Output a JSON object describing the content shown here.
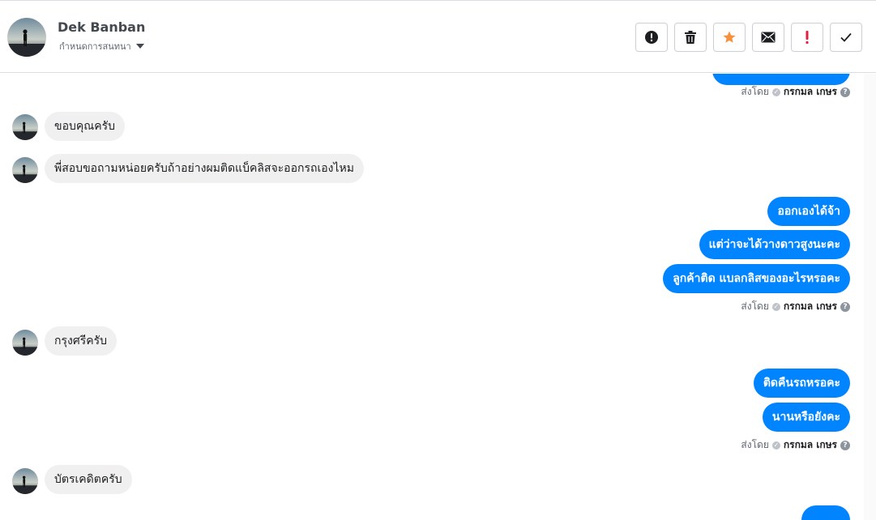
{
  "header": {
    "contact_name": "Dek Banban",
    "conversation_menu": "กำหนดการสนทนา",
    "actions": [
      {
        "name": "alert-button",
        "icon": "exclamation-circle-icon"
      },
      {
        "name": "delete-button",
        "icon": "trash-icon"
      },
      {
        "name": "star-button",
        "icon": "star-icon",
        "color": "#f5923e"
      },
      {
        "name": "mail-button",
        "icon": "envelope-icon"
      },
      {
        "name": "important-button",
        "icon": "exclamation-icon",
        "color": "#e41e3f"
      },
      {
        "name": "done-button",
        "icon": "checkmark-icon"
      }
    ]
  },
  "sent_by_prefix": "ส่งโดย",
  "sent_by_name": "กรกมล เกษร",
  "messages": {
    "in_1": "ขอบคุณครับ",
    "in_2": "พี่สอบขอถามหน่อยครับถ้าอย่างผมติดแบ็คลิสจะออกรถเองไหม",
    "out_1": "ออกเองได้จ้า",
    "out_2": "แต่ว่าจะได้วางดาวสูงนะคะ",
    "out_3": "ลูกค้าติด แบลกลิสของอะไรหรอคะ",
    "in_3": "กรุงศรีครับ",
    "out_4": "ติดคืนรถหรอคะ",
    "out_5": "นานหรือยังคะ",
    "in_4": "บัตรเคดิตครับ"
  },
  "colors": {
    "outgoing_bubble": "#0084ff",
    "incoming_bubble": "#f0f0f0"
  }
}
